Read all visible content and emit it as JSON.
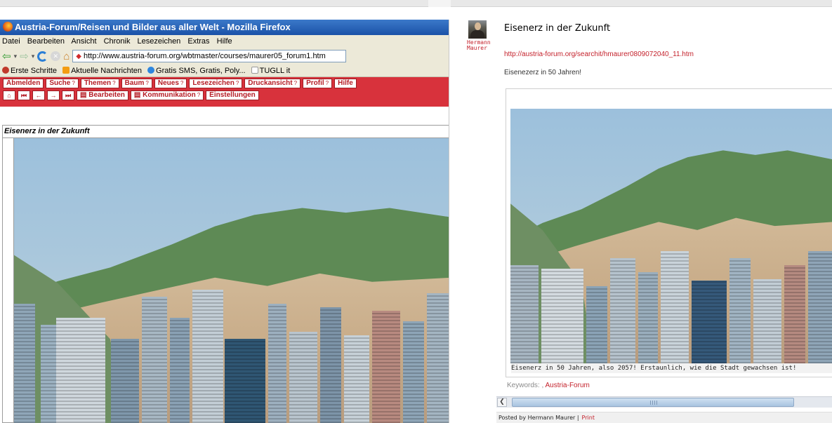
{
  "firefox": {
    "window_title": "Austria-Forum/Reisen und Bilder aus aller Welt - Mozilla Firefox",
    "menu": [
      "Datei",
      "Bearbeiten",
      "Ansicht",
      "Chronik",
      "Lesezeichen",
      "Extras",
      "Hilfe"
    ],
    "url": "http://www.austria-forum.org/wbtmaster/courses/maurer05_forum1.htm",
    "bookmarks": [
      "Erste Schritte",
      "Aktuelle Nachrichten",
      "Gratis SMS, Gratis, Poly...",
      "TUGLL it"
    ],
    "site_nav_row1": [
      "Abmelden",
      "Suche",
      "Themen",
      "Baum",
      "Neues",
      "Lesezeichen",
      "Druckansicht",
      "Profil",
      "Hilfe"
    ],
    "site_nav_row2": [
      "Bearbeiten",
      "Kommunikation",
      "Einstellungen"
    ],
    "help_marker": "?",
    "article_title": "Eisenerz in der Zukunft"
  },
  "post": {
    "author": "Hermann Maurer",
    "title": "Eisenerz in der Zukunft",
    "link": "http://austria-forum.org/searchit/hmaurer0809072040_11.htm",
    "description": "Eisenezerz in 50 Jahren!",
    "caption": "Eisenerz in 50 Jahren, also 2057! Erstaunlich, wie die Stadt gewachsen ist!",
    "keywords_label": "Keywords:",
    "keywords_sep": ",",
    "keywords_link": "Austria-Forum",
    "posted_by": "Posted by Hermann Maurer |",
    "print": "Print"
  },
  "colors": {
    "brand_red": "#d8323c",
    "link_red": "#c4222c",
    "titlebar_blue": "#1b52a8"
  },
  "icons": [
    "firefox-logo-icon",
    "back-icon",
    "forward-icon",
    "reload-icon",
    "stop-icon",
    "home-icon",
    "page-favicon-icon",
    "avatar-photo"
  ]
}
